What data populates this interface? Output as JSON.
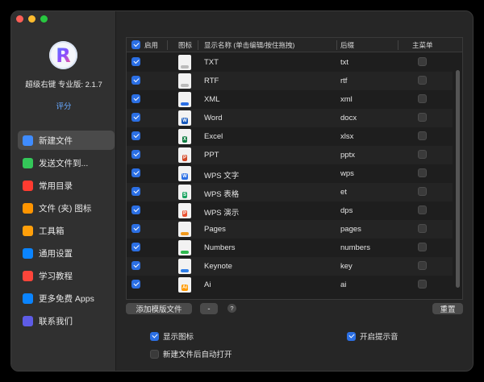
{
  "app": {
    "version_text": "超级右键 专业版: 2.1.7",
    "rate_label": "评分"
  },
  "sidebar": {
    "items": [
      {
        "label": "新建文件",
        "icon": "new-file-icon",
        "color": "#3f8cff",
        "active": true
      },
      {
        "label": "发送文件到...",
        "icon": "send-file-icon",
        "color": "#34c759",
        "active": false
      },
      {
        "label": "常用目录",
        "icon": "heart-icon",
        "color": "#ff3b30",
        "active": false
      },
      {
        "label": "文件 (夹) 图标",
        "icon": "icon-icon",
        "color": "#ff9500",
        "active": false
      },
      {
        "label": "工具箱",
        "icon": "toolbox-icon",
        "color": "#ff9f0a",
        "active": false
      },
      {
        "label": "通用设置",
        "icon": "gear-icon",
        "color": "#0a84ff",
        "active": false
      },
      {
        "label": "学习教程",
        "icon": "tutorial-icon",
        "color": "#ff453a",
        "active": false
      },
      {
        "label": "更多免费 Apps",
        "icon": "app-store-icon",
        "color": "#0a84ff",
        "active": false
      },
      {
        "label": "联系我们",
        "icon": "contact-icon",
        "color": "#5e5ce6",
        "active": false
      }
    ]
  },
  "table": {
    "headers": {
      "enabled": "启用",
      "icon": "图标",
      "name": "显示名称 (单击编辑/按住拖拽)",
      "ext": "后缀",
      "main_menu": "主菜单"
    },
    "rows": [
      {
        "name": "TXT",
        "ext": "txt",
        "icon": "txt-file-icon",
        "tag": "",
        "tag_color": "#bbbbbb"
      },
      {
        "name": "RTF",
        "ext": "rtf",
        "icon": "rtf-file-icon",
        "tag": "",
        "tag_color": "#bbbbbb"
      },
      {
        "name": "XML",
        "ext": "xml",
        "icon": "xml-file-icon",
        "tag": "",
        "tag_color": "#2b6fe4"
      },
      {
        "name": "Word",
        "ext": "docx",
        "icon": "word-icon",
        "tag": "W",
        "tag_color": "#185abd"
      },
      {
        "name": "Excel",
        "ext": "xlsx",
        "icon": "excel-icon",
        "tag": "X",
        "tag_color": "#107c41"
      },
      {
        "name": "PPT",
        "ext": "pptx",
        "icon": "powerpoint-icon",
        "tag": "P",
        "tag_color": "#d24726"
      },
      {
        "name": "WPS 文字",
        "ext": "wps",
        "icon": "wps-writer-icon",
        "tag": "W",
        "tag_color": "#2b6fe4"
      },
      {
        "name": "WPS 表格",
        "ext": "et",
        "icon": "wps-spreadsheet-icon",
        "tag": "S",
        "tag_color": "#1aa260"
      },
      {
        "name": "WPS 演示",
        "ext": "dps",
        "icon": "wps-presentation-icon",
        "tag": "P",
        "tag_color": "#e8502f"
      },
      {
        "name": "Pages",
        "ext": "pages",
        "icon": "pages-icon",
        "tag": "",
        "tag_color": "#f39a1d"
      },
      {
        "name": "Numbers",
        "ext": "numbers",
        "icon": "numbers-icon",
        "tag": "",
        "tag_color": "#2fb84e"
      },
      {
        "name": "Keynote",
        "ext": "key",
        "icon": "keynote-icon",
        "tag": "",
        "tag_color": "#2f7fe8"
      },
      {
        "name": "Ai",
        "ext": "ai",
        "icon": "illustrator-icon",
        "tag": "Ai",
        "tag_color": "#ff9a00"
      }
    ]
  },
  "toolbar": {
    "add_template_label": "添加模版文件",
    "remove_label": "-",
    "help_label": "?",
    "reset_label": "重置"
  },
  "options": {
    "show_icons_label": "显示图标",
    "open_after_create_label": "新建文件后自动打开",
    "sound_label": "开启提示音"
  }
}
